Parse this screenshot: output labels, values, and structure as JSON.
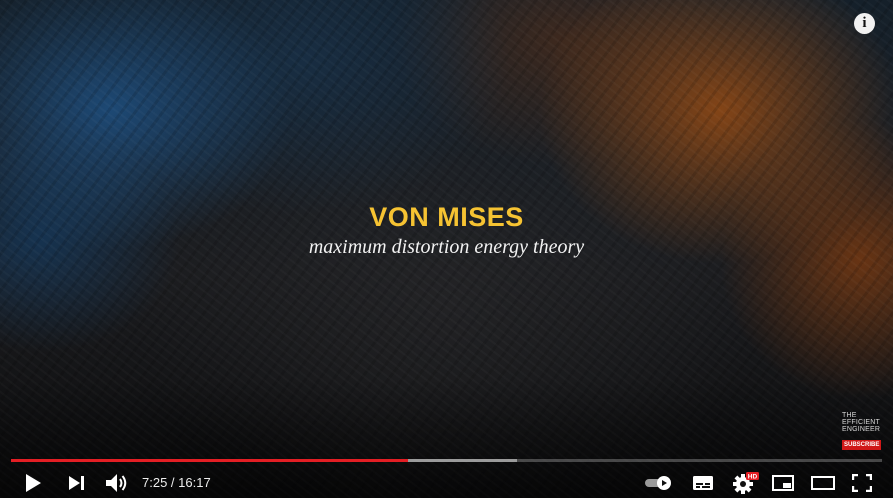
{
  "video": {
    "title": "VON MISES",
    "subtitle": "maximum distortion energy theory",
    "info_icon": "info-icon",
    "watermark": {
      "line1": "THE",
      "line2": "EFFICIENT",
      "line3": "ENGINEER",
      "subscribe": "SUBSCRIBE"
    }
  },
  "controls": {
    "current_time": "7:25",
    "duration": "16:17",
    "time_display": "7:25 / 16:17",
    "played_fraction": 0.456,
    "buffered_fraction": 0.581,
    "quality_badge": "HD",
    "icons": [
      "play-icon",
      "next-icon",
      "volume-icon",
      "autoplay-toggle-icon",
      "subtitles-icon",
      "settings-icon",
      "miniplayer-icon",
      "theater-mode-icon",
      "fullscreen-icon"
    ]
  },
  "colors": {
    "title": "#f6c332",
    "progress_played": "#e31e24",
    "hd_badge": "#e31e24"
  }
}
